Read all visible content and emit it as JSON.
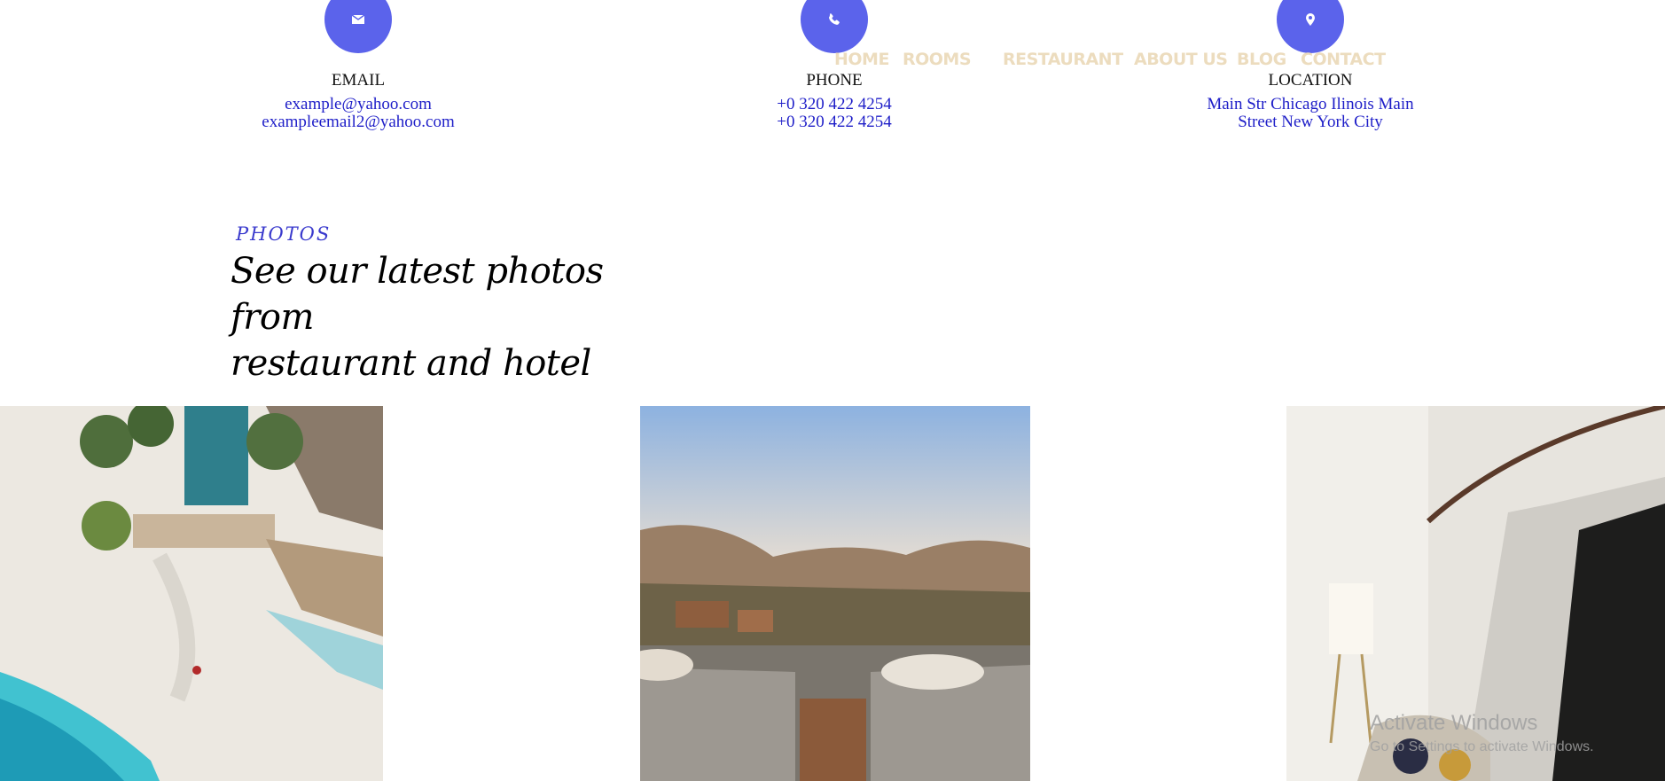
{
  "contacts": [
    {
      "icon": "envelope-icon",
      "label": "EMAIL",
      "lines": [
        "example@yahoo.com",
        "exampleemail2@yahoo.com"
      ]
    },
    {
      "icon": "phone-icon",
      "label": "PHONE",
      "lines": [
        "+0 320 422 4254",
        "+0 320 422 4254"
      ]
    },
    {
      "icon": "map-pin-icon",
      "label": "LOCATION",
      "lines": [
        "Main Str Chicago Ilinois Main",
        "Street New York City"
      ]
    }
  ],
  "nav": {
    "items": [
      "HOME",
      "ROOMS",
      "RESTAURANT",
      "ABOUT US",
      "BLOG",
      "CONTACT"
    ]
  },
  "photos_section": {
    "eyebrow": "PHOTOS",
    "heading_line1": "See our latest photos from",
    "heading_line2": "restaurant and hotel"
  },
  "gallery": [
    {
      "subject": "aerial beach resort pool"
    },
    {
      "subject": "mountain view terrace loungers"
    },
    {
      "subject": "marble staircase lobby"
    }
  ],
  "watermark": {
    "title": "Activate Windows",
    "subtitle": "Go to Settings to activate Windows."
  },
  "colors": {
    "accent": "#5b63eb",
    "nav_text": "#ecdcbe",
    "link_text": "#1e1ec8"
  }
}
